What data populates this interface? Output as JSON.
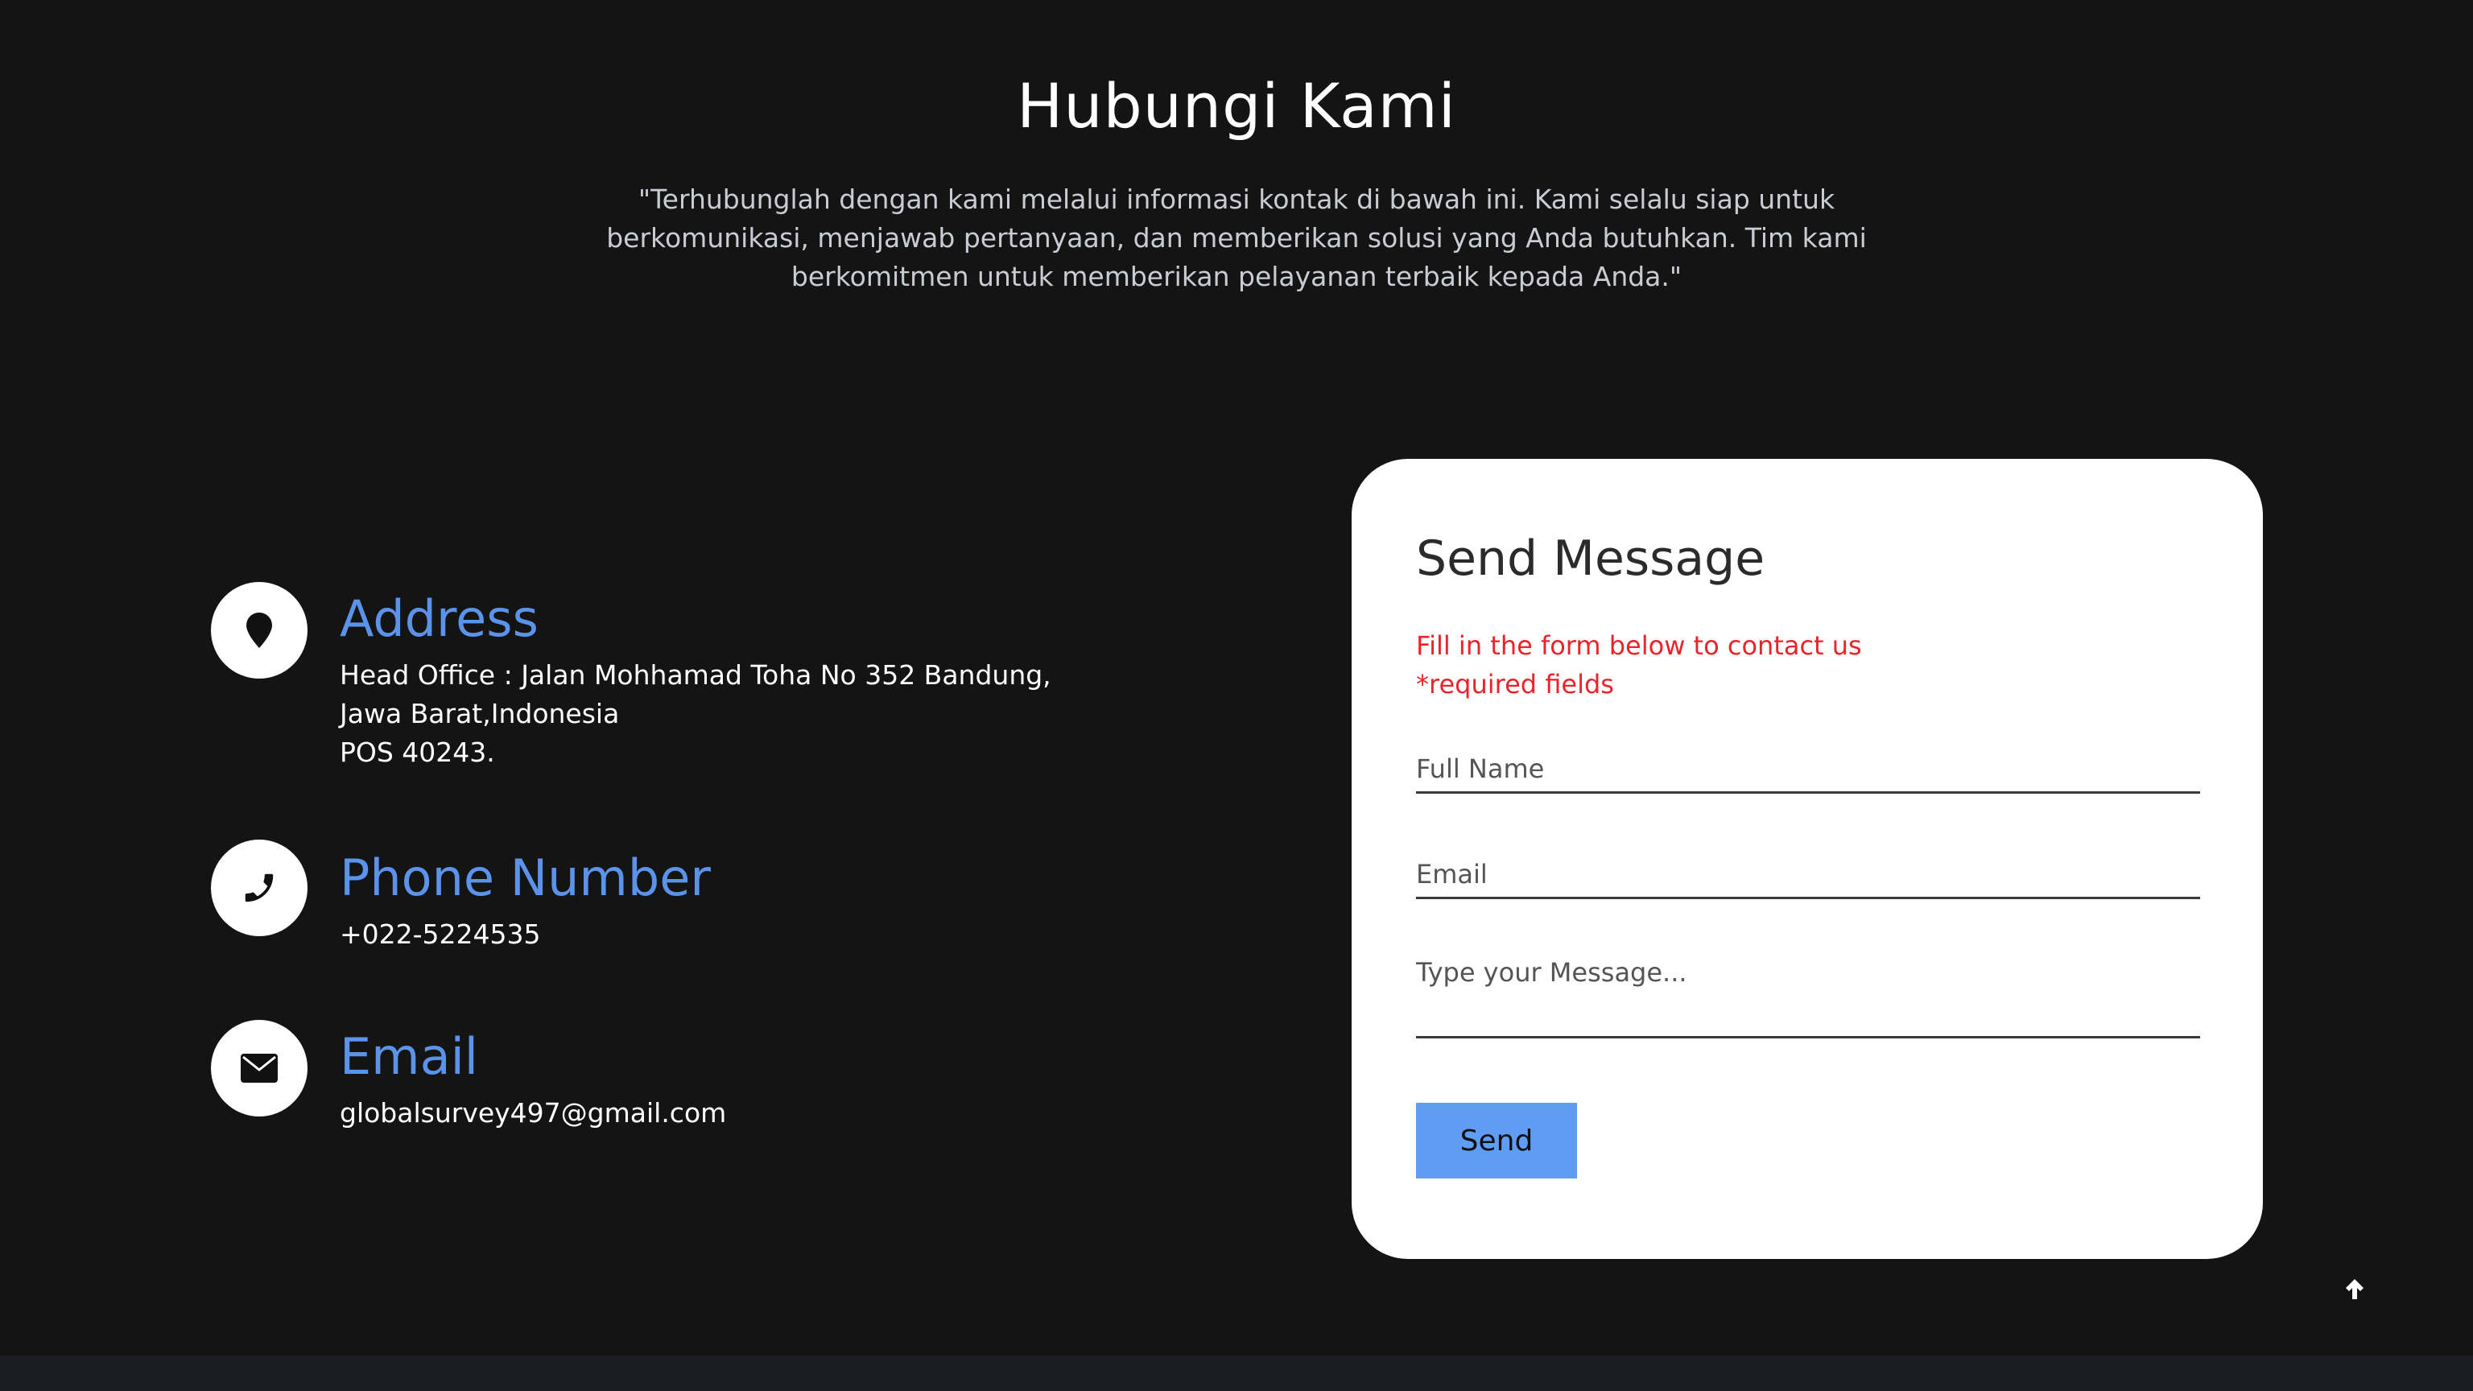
{
  "header": {
    "title": "Hubungi Kami",
    "intro_line1": "\"Terhubunglah dengan kami melalui informasi kontak di bawah ini. Kami selalu siap untuk",
    "intro_line2": "berkomunikasi, menjawab pertanyaan, dan memberikan solusi yang Anda butuhkan. Tim kami",
    "intro_line3": "berkomitmen untuk memberikan pelayanan terbaik kepada Anda.\""
  },
  "contacts": {
    "address": {
      "icon": "map-pin-icon",
      "title": "Address",
      "line1": "Head Office : Jalan Mohhamad Toha No 352 Bandung,",
      "line2": "Jawa Barat,Indonesia",
      "line3": "POS 40243."
    },
    "phone": {
      "icon": "phone-icon",
      "title": "Phone Number",
      "value": "+022-5224535"
    },
    "email": {
      "icon": "envelope-icon",
      "title": "Email",
      "value": "globalsurvey497@gmail.com"
    }
  },
  "form": {
    "title": "Send Message",
    "note": "Fill in the form below to contact us",
    "required_note": "*required fields",
    "full_name_placeholder": "Full Name",
    "email_placeholder": "Email",
    "message_placeholder": "Type your Message...",
    "send_label": "Send"
  },
  "back_to_top": {
    "icon": "arrow-up-icon"
  },
  "colors": {
    "background": "#141415",
    "accent_blue": "#5b93eb",
    "button_blue": "#5f9cf4",
    "required_red": "#e8242c",
    "card_white": "#ffffff"
  }
}
